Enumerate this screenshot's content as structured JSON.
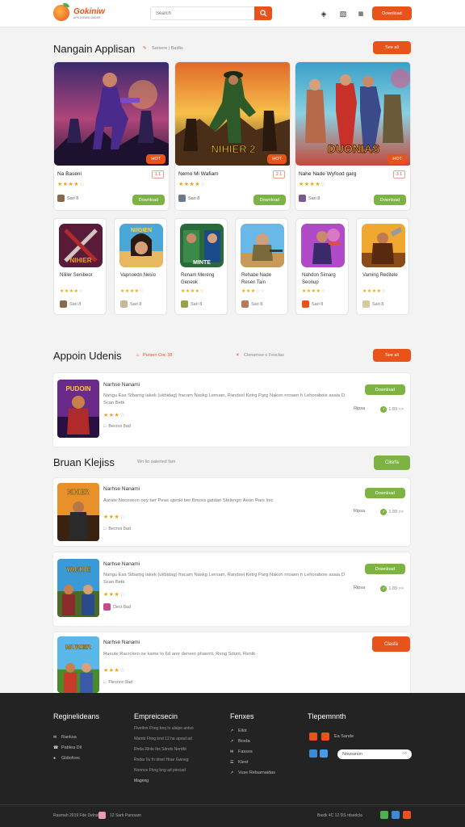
{
  "header": {
    "brand": "Gokiniw",
    "brand_sub": "APK DOWNLOADER",
    "search_placeholder": "Search",
    "cta": "Download"
  },
  "featured": {
    "title": "Nangain Applisan",
    "subtitle": "Sarsere | Badlis",
    "more": "See all",
    "cards": [
      {
        "name": "Na Baseni",
        "tag": "1 1",
        "badge": "HOT",
        "rating": 4,
        "dev": "Sari 8",
        "button": "Download",
        "art_text": ""
      },
      {
        "name": "Nemo Mi Wafiam",
        "tag": "2 1",
        "badge": "HOT",
        "rating": 4,
        "dev": "Sari 8",
        "button": "Download",
        "art_text": "NIHIER 2"
      },
      {
        "name": "Nahe Nade Wyfood garg",
        "tag": "3 1",
        "badge": "HOT",
        "rating": 4,
        "dev": "Sari 8",
        "button": "Download",
        "art_text": "DUONIAS"
      }
    ]
  },
  "small_apps": [
    {
      "name": "Nililer Senibeor",
      "rating": 4,
      "dev": "Sari 8",
      "art_text": "NIHIER"
    },
    {
      "name": "Vapnoedn Nesio",
      "rating": 4,
      "dev": "Sari 8",
      "art_text": "NIIGIEN"
    },
    {
      "name": "Renam Mereng Geneok",
      "rating": 4,
      "dev": "Sari 8",
      "art_text": "MINTE"
    },
    {
      "name": "Rehabe Nade Resen Tain",
      "rating": 4,
      "dev": "Sari 8",
      "art_text": ""
    },
    {
      "name": "Nahdon Simarg Seonup",
      "rating": 4,
      "dev": "Sari 8",
      "art_text": ""
    },
    {
      "name": "Vaming Reditele",
      "rating": 4,
      "dev": "Sari 8",
      "art_text": ""
    }
  ],
  "updates": {
    "title": "Appoin Udenis",
    "sub1": "Pursen Coc 38",
    "sub2": "Clenamse o Fesclas",
    "more": "See all",
    "items": [
      {
        "title": "Narhse Nanami",
        "desc": "Narigu Eas Stbarrig lakek (ukbidag) fracam Naskg Lerruan, Randsel Ketrg Parg Nakon nroaen h Lehoraboie asaia D Scan Betk",
        "rating": 3,
        "meta": "Becnoi 8ad",
        "size": "Ripsa",
        "version": "1.89 >>",
        "button": "Download",
        "art_text": "PUDOIN"
      }
    ]
  },
  "latest": {
    "title": "Bruan Klejiss",
    "subtitle": "Wn lio oalerted fam",
    "more": "Clisrfa",
    "items": [
      {
        "title": "Narhse Nanami",
        "desc": "Aarate Nocoseon oey tarr Peas ujwskl ber Bmora gatdari Stelengrr Aeon Pars Inic",
        "rating": 3,
        "meta": "Becnoi 8ad",
        "size": "Ripsa",
        "version": "1.89 >>",
        "button": "Download",
        "art_text": "NIHIER"
      },
      {
        "title": "Narhse Nanami",
        "desc": "Narigu Eas Stbarrig lakek (ukbidag) fracam Naskg Lerruan, Randsel Ketrg Parg Nakon nroaen h Lehoraboie asaia D Scan Betk",
        "rating": 3,
        "meta": "Dect 8ad",
        "size": "Ripsa",
        "version": "1.89 >>",
        "button": "Download",
        "art_text": "YAGIOE"
      },
      {
        "title": "Narhse Nanami",
        "desc": "Rueute Racrcken oe kame to 6d aror deneer phaerrit, Reng Sdunt, Rentk",
        "rating": 3,
        "meta": "Flesnoc 8ad",
        "size": "",
        "version": "",
        "button": "Clasfa",
        "art_text": "MURIER"
      }
    ]
  },
  "footer": {
    "col1": {
      "title": "Reginelideans",
      "links": [
        "Ranksa",
        "Pablea Dil",
        "Gldiofcec"
      ]
    },
    "col2": {
      "title": "Empreicsecin",
      "lines": [
        "Fivetlno Fhng bnq lo ulaipe antso",
        "Wamb Fhng bnd 12 ha aprad ad",
        "Rnda Rlnle Ibs Sdnds Nerdbt",
        "Rndar Ilu fn dmel Hrae Gwneg",
        "Nonnce Fhng bng ad pieciad",
        "Magnng"
      ]
    },
    "col3": {
      "title": "Fenxes",
      "links": [
        "Eilot",
        "Borda",
        "Fassos",
        "Klest",
        "Vuse Relsarnaidas"
      ]
    },
    "col4": {
      "title": "Tlepemnnth",
      "social": "Ea Sande",
      "newsletter": "Novoanon"
    },
    "copyright": "Rasmah 2019 Fde Delnst",
    "policy": "12 Sarb Panrsam",
    "right_note": "Bastk 4C 12 DS rdsedcla"
  },
  "colors": {
    "accent": "#e8531c",
    "green": "#7cb342",
    "footer_bg": "#232323",
    "star": "#f2a700"
  }
}
